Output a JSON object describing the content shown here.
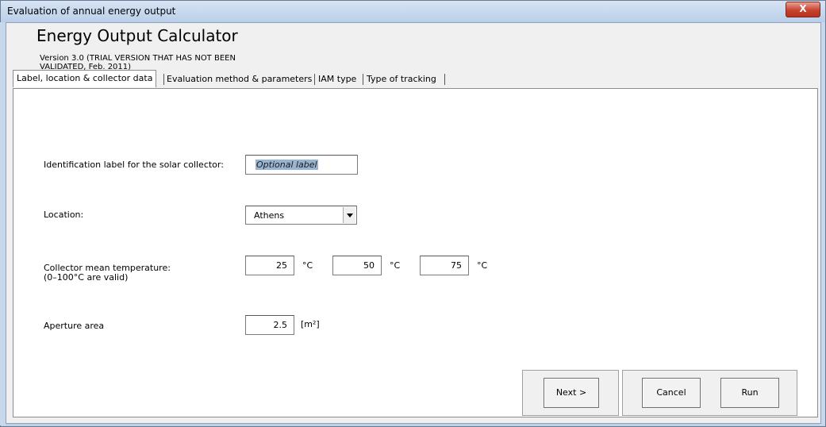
{
  "window": {
    "title": "Evaluation of annual energy output",
    "close_glyph": "X"
  },
  "header": {
    "app_title": "Energy Output Calculator",
    "version_text": "Version 3.0 (TRIAL VERSION THAT HAS NOT BEEN VALIDATED, Feb. 2011)"
  },
  "tabs": [
    {
      "label": "Label, location & collector data",
      "active": true
    },
    {
      "label": "Evaluation method & parameters",
      "active": false
    },
    {
      "label": "IAM type",
      "active": false
    },
    {
      "label": "Type of tracking",
      "active": false
    }
  ],
  "form": {
    "identification": {
      "label": "Identification label for the solar collector:",
      "value": "Optional label"
    },
    "location": {
      "label": "Location:",
      "value": "Athens"
    },
    "temperature": {
      "label": "Collector mean temperature:",
      "sublabel": "(0–100°C are valid)",
      "values": [
        "25",
        "50",
        "75"
      ],
      "unit": "°C"
    },
    "aperture": {
      "label": "Aperture area",
      "value": "2.5",
      "unit": "[m²]"
    }
  },
  "buttons": {
    "next": "Next >",
    "cancel": "Cancel",
    "run": "Run"
  }
}
